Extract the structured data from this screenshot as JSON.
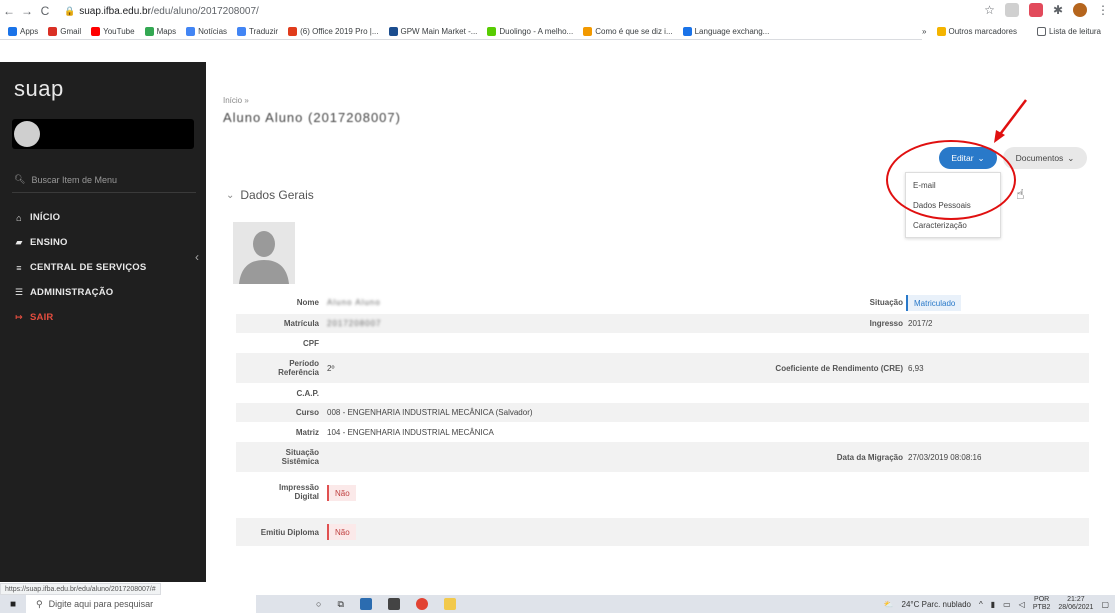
{
  "browser": {
    "url_host": "suap.ifba.edu.br",
    "url_path": "/edu/aluno/2017208007/",
    "bookmarks": [
      {
        "label": "Apps",
        "color": "#1a73e8"
      },
      {
        "label": "Gmail",
        "color": "#d93025"
      },
      {
        "label": "YouTube",
        "color": "#ff0000"
      },
      {
        "label": "Maps",
        "color": "#34a853"
      },
      {
        "label": "Notícias",
        "color": "#4285f4"
      },
      {
        "label": "Traduzir",
        "color": "#4285f4"
      },
      {
        "label": "(6) Office 2019 Pro |...",
        "color": "#e03c1c"
      },
      {
        "label": "GPW Main Market -...",
        "color": "#1b4d8f"
      },
      {
        "label": "Duolingo - A melho...",
        "color": "#58cc02"
      },
      {
        "label": "Como é que se diz i...",
        "color": "#f29900"
      },
      {
        "label": "Language exchang...",
        "color": "#1a73e8"
      }
    ],
    "bookmarks_more": "»",
    "other_bookmarks": "Outros marcadores",
    "reading_list": "Lista de leitura",
    "status_url": "https://suap.ifba.edu.br/edu/aluno/2017208007/#"
  },
  "sidebar": {
    "logo": "suap",
    "search_placeholder": "Buscar Item de Menu",
    "items": [
      {
        "label": "INÍCIO",
        "icon": "home-icon"
      },
      {
        "label": "ENSINO",
        "icon": "ensino-icon"
      },
      {
        "label": "CENTRAL DE SERVIÇOS",
        "icon": "list-icon"
      },
      {
        "label": "ADMINISTRAÇÃO",
        "icon": "list-icon"
      },
      {
        "label": "SAIR",
        "icon": "logout-icon"
      }
    ]
  },
  "main": {
    "breadcrumb": "Início »",
    "title": "Aluno Aluno (2017208007)",
    "editar_label": "Editar",
    "documentos_label": "Documentos",
    "dropdown_items": [
      "E-mail",
      "Dados Pessoais",
      "Caracterização"
    ],
    "section_title": "Dados Gerais"
  },
  "details": {
    "nome_label": "Nome",
    "nome_value": "Aluno Aluno",
    "situacao_label": "Situação",
    "situacao_value": "Matriculado",
    "matricula_label": "Matrícula",
    "matricula_value": "2017208007",
    "ingresso_label": "Ingresso",
    "ingresso_value": "2017/2",
    "cpf_label": "CPF",
    "periodo_label_1": "Período",
    "periodo_label_2": "Referência",
    "periodo_value": "2º",
    "cre_label": "Coeficiente de Rendimento (CRE)",
    "cre_value": "6,93",
    "cap_label": "C.A.P.",
    "curso_label": "Curso",
    "curso_value": "008 - ENGENHARIA INDUSTRIAL MECÂNICA (Salvador)",
    "matriz_label": "Matriz",
    "matriz_value": "104 - ENGENHARIA INDUSTRIAL MECÂNICA",
    "situacao_sist_label_1": "Situação",
    "situacao_sist_label_2": "Sistêmica",
    "data_migracao_label": "Data da Migração",
    "data_migracao_value": "27/03/2019 08:08:16",
    "impressao_label_1": "Impressão",
    "impressao_label_2": "Digital",
    "impressao_value": "Não",
    "diploma_label": "Emitiu Diploma",
    "diploma_value": "Não"
  },
  "taskbar": {
    "search_placeholder": "Digite aqui para pesquisar",
    "weather": "24°C Parc. nublado",
    "lang_1": "POR",
    "lang_2": "PTB2",
    "time": "21:27",
    "date": "28/06/2021"
  },
  "colors": {
    "sidebar_bg": "#1f1f1f",
    "primary": "#2979c9",
    "danger": "#e05050",
    "annotation": "#e01010"
  }
}
